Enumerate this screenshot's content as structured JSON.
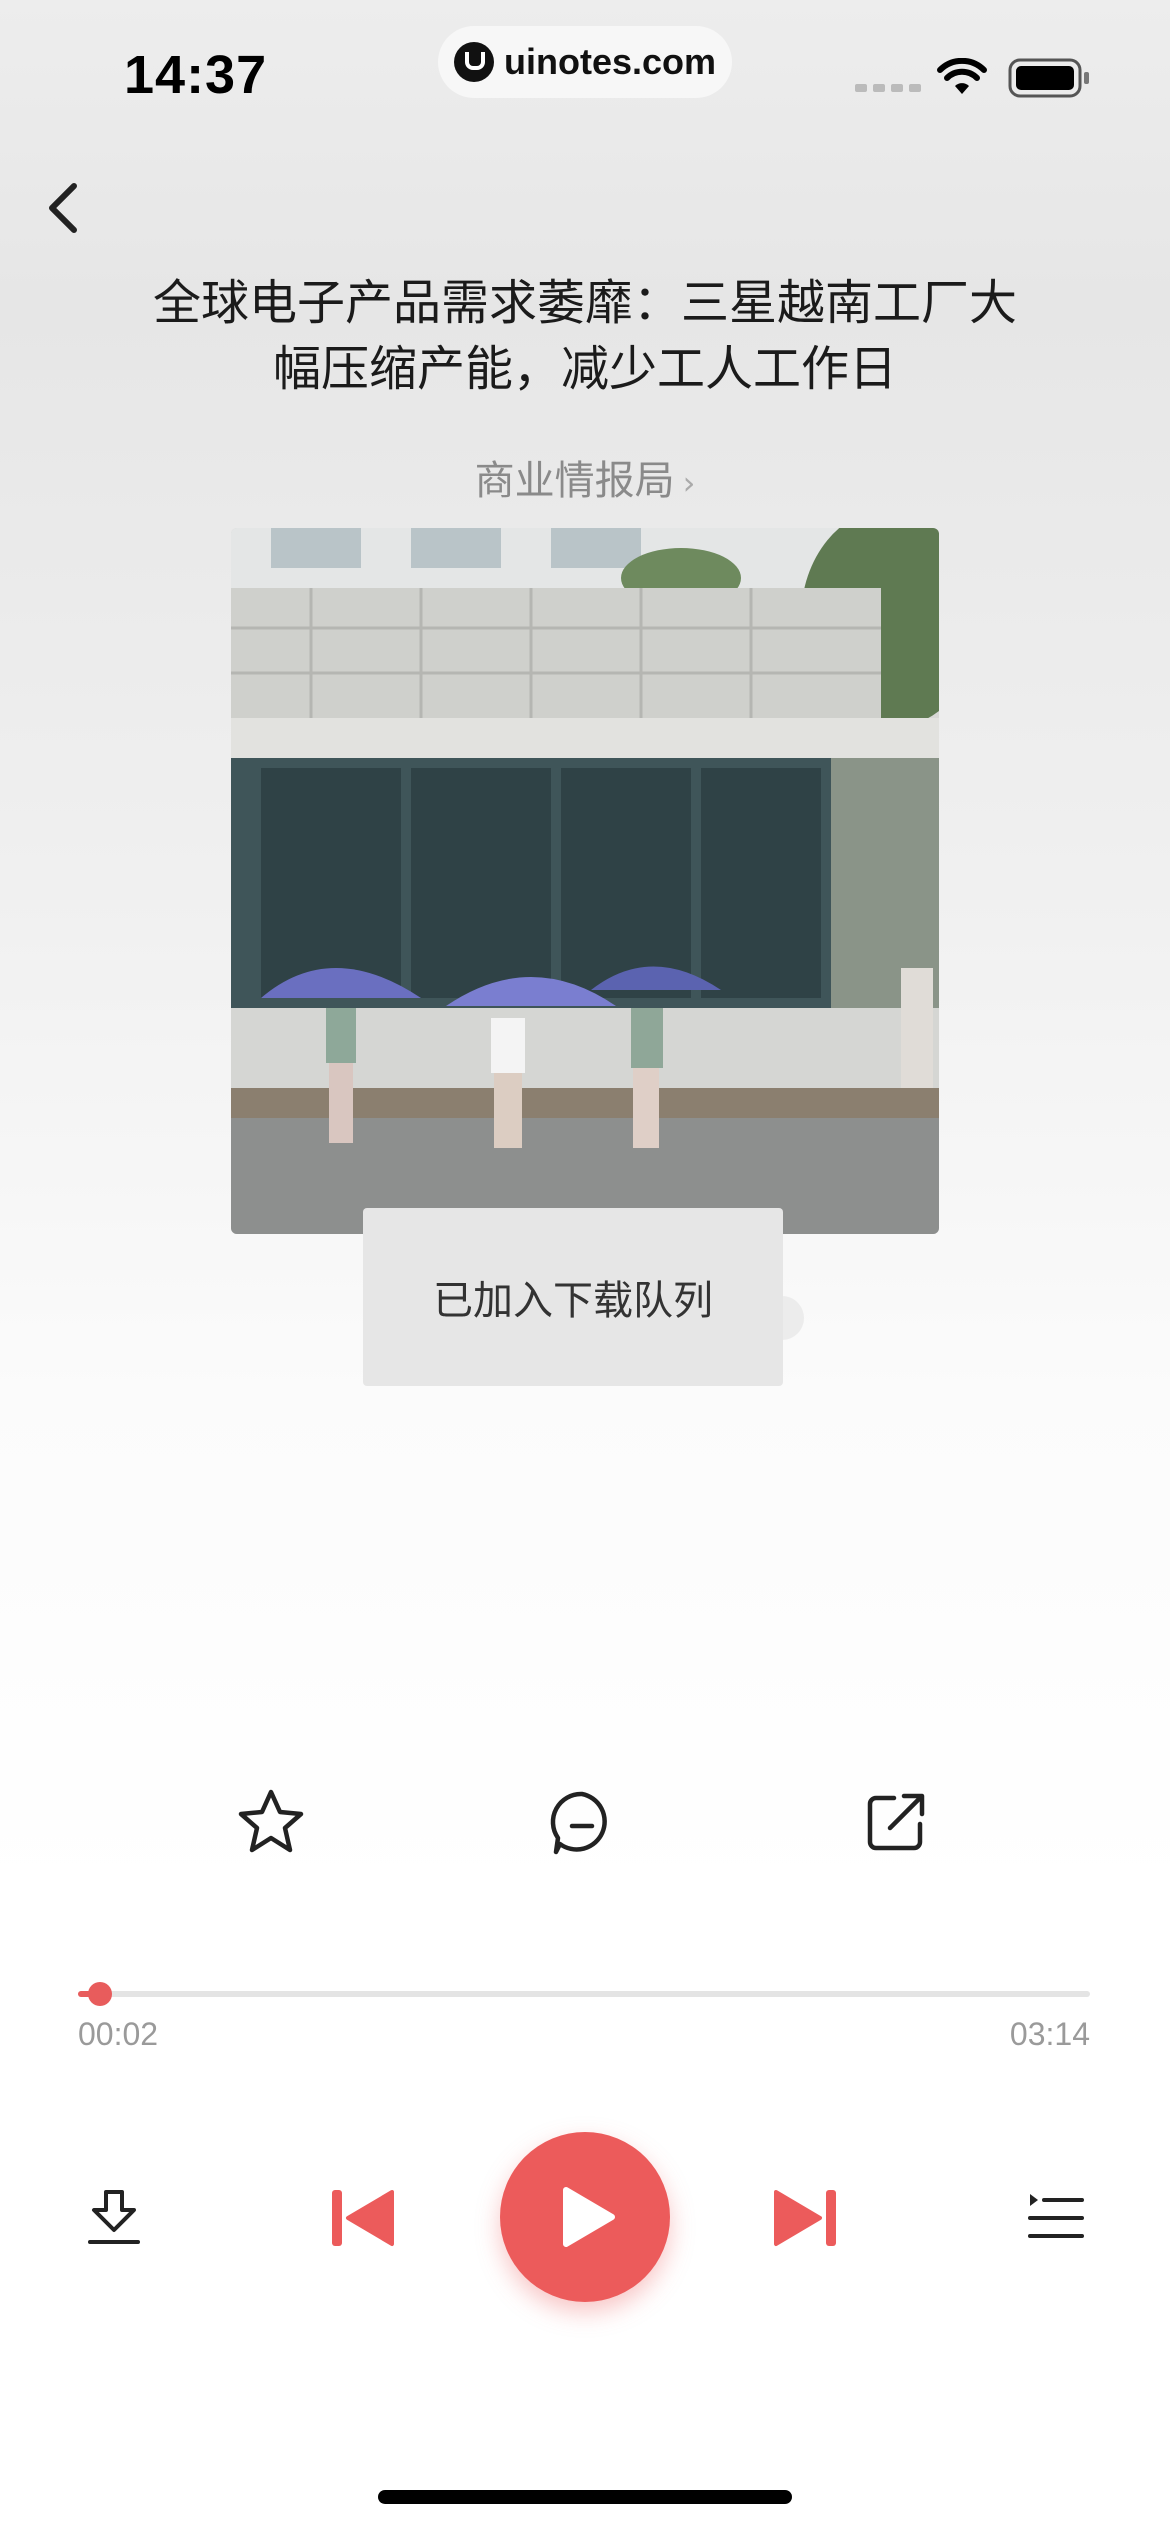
{
  "status_bar": {
    "time": "14:37",
    "site": "uinotes.com"
  },
  "article": {
    "title_line1": "全球电子产品需求萎靡：三星越南工厂大",
    "title_line2": "幅压缩产能，减少工人工作日",
    "source": "商业情报局",
    "source_chevron": "›"
  },
  "toast": {
    "message": "已加入下载队列"
  },
  "actions": {
    "items": [
      "star-icon",
      "comment-icon",
      "share-icon"
    ]
  },
  "player": {
    "elapsed": "00:02",
    "duration": "03:14",
    "progress_fraction": 0.0107
  },
  "controls": {
    "items": [
      "download-icon",
      "previous-icon",
      "play-icon",
      "next-icon",
      "playlist-icon"
    ]
  },
  "colors": {
    "accent": "#ec5b5b"
  }
}
